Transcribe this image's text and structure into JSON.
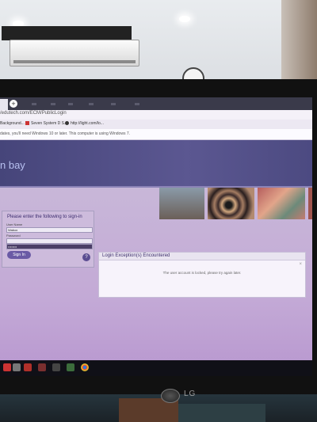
{
  "browser": {
    "new_tab_symbol": "+",
    "address": "/edutech.com/ECM/PublicLogin",
    "bookmarks": [
      {
        "label": "Background...",
        "icon": "image-icon",
        "color": "#d44"
      },
      {
        "label": "Seven System D S...",
        "icon": "bookmark-icon",
        "color": "#c33"
      },
      {
        "label": "http://light.com/lo...",
        "icon": "link-icon",
        "color": "#333"
      }
    ],
    "info_bar_text": "dates, you'll need Windows 10 or later. This computer is using Windows 7."
  },
  "site": {
    "brand_fragment": "n bay"
  },
  "signin": {
    "title": "Please enter the following to sign-in",
    "username_label": "User Name",
    "username_value": "Wabox",
    "password_label": "Password",
    "password_value": "••••••••",
    "button_label": "Sign In",
    "help_symbol": "?"
  },
  "dialog": {
    "title": "Login Exception(s) Encountered",
    "close_symbol": "×",
    "message": "The user account is locked, please try again later."
  },
  "monitor": {
    "brand": "LG"
  },
  "colors": {
    "header": "#4c4a81",
    "accent": "#6a5aa5",
    "dialog_title": "#3d2f6c"
  }
}
